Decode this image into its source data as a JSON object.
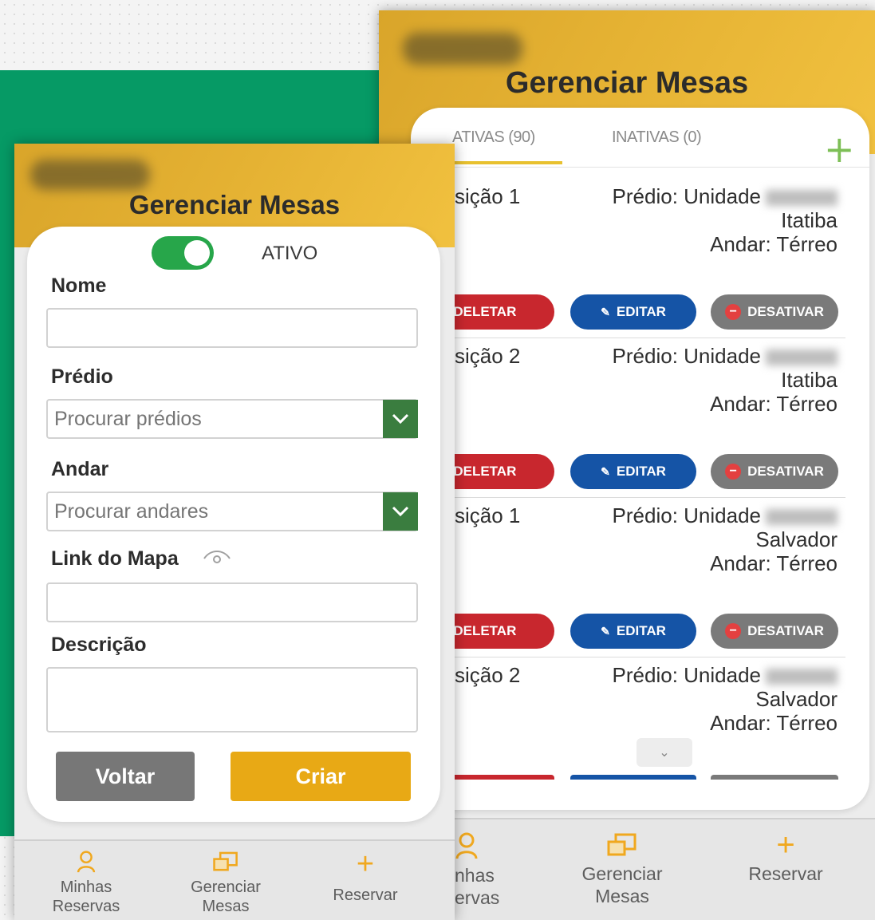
{
  "back_screen": {
    "title": "Gerenciar Mesas",
    "tabs": [
      {
        "label": "ATIVAS (90)"
      },
      {
        "label": "INATIVAS (0)"
      }
    ],
    "add_icon": "plus-icon",
    "entries": [
      {
        "position": "sição 1",
        "building": "Prédio: Unidade",
        "city": "Itatiba",
        "floor": "Andar: Térreo"
      },
      {
        "position": "sição 2",
        "building": "Prédio: Unidade",
        "city": "Itatiba",
        "floor": "Andar: Térreo"
      },
      {
        "position": "sição 1",
        "building": "Prédio: Unidade",
        "city": "Salvador",
        "floor": "Andar: Térreo"
      },
      {
        "position": "sição 2",
        "building": "Prédio: Unidade",
        "city": "Salvador",
        "floor": "Andar: Térreo"
      }
    ],
    "actions": {
      "delete": "DELETAR",
      "edit": "EDITAR",
      "deactivate": "DESATIVAR"
    },
    "nav": [
      {
        "line1": "nhas",
        "line2": "ervas",
        "icon": "user-icon"
      },
      {
        "line1": "Gerenciar",
        "line2": "Mesas",
        "icon": "desk-icon"
      },
      {
        "line1": "Reservar",
        "line2": "",
        "icon": "plus-icon"
      }
    ]
  },
  "front_screen": {
    "title": "Gerenciar Mesas",
    "toggle_label": "ATIVO",
    "toggle_on": true,
    "fields": {
      "nome_label": "Nome",
      "predio_label": "Prédio",
      "predio_placeholder": "Procurar prédios",
      "andar_label": "Andar",
      "andar_placeholder": "Procurar andares",
      "link_label": "Link do Mapa",
      "descricao_label": "Descrição"
    },
    "buttons": {
      "back": "Voltar",
      "create": "Criar"
    },
    "nav": [
      {
        "line1": "Minhas",
        "line2": "Reservas",
        "icon": "user-icon"
      },
      {
        "line1": "Gerenciar",
        "line2": "Mesas",
        "icon": "desk-icon"
      },
      {
        "line1": "Reservar",
        "line2": "",
        "icon": "plus-icon"
      }
    ]
  },
  "colors": {
    "green_background": "#069a65",
    "header_gold": "#e5b233",
    "delete_red": "#c8272e",
    "edit_blue": "#1554a6",
    "deactivate_gray": "#7a7a7a",
    "toggle_green": "#27a64a",
    "create_gold": "#e8a915",
    "select_green": "#3a7d3f"
  }
}
